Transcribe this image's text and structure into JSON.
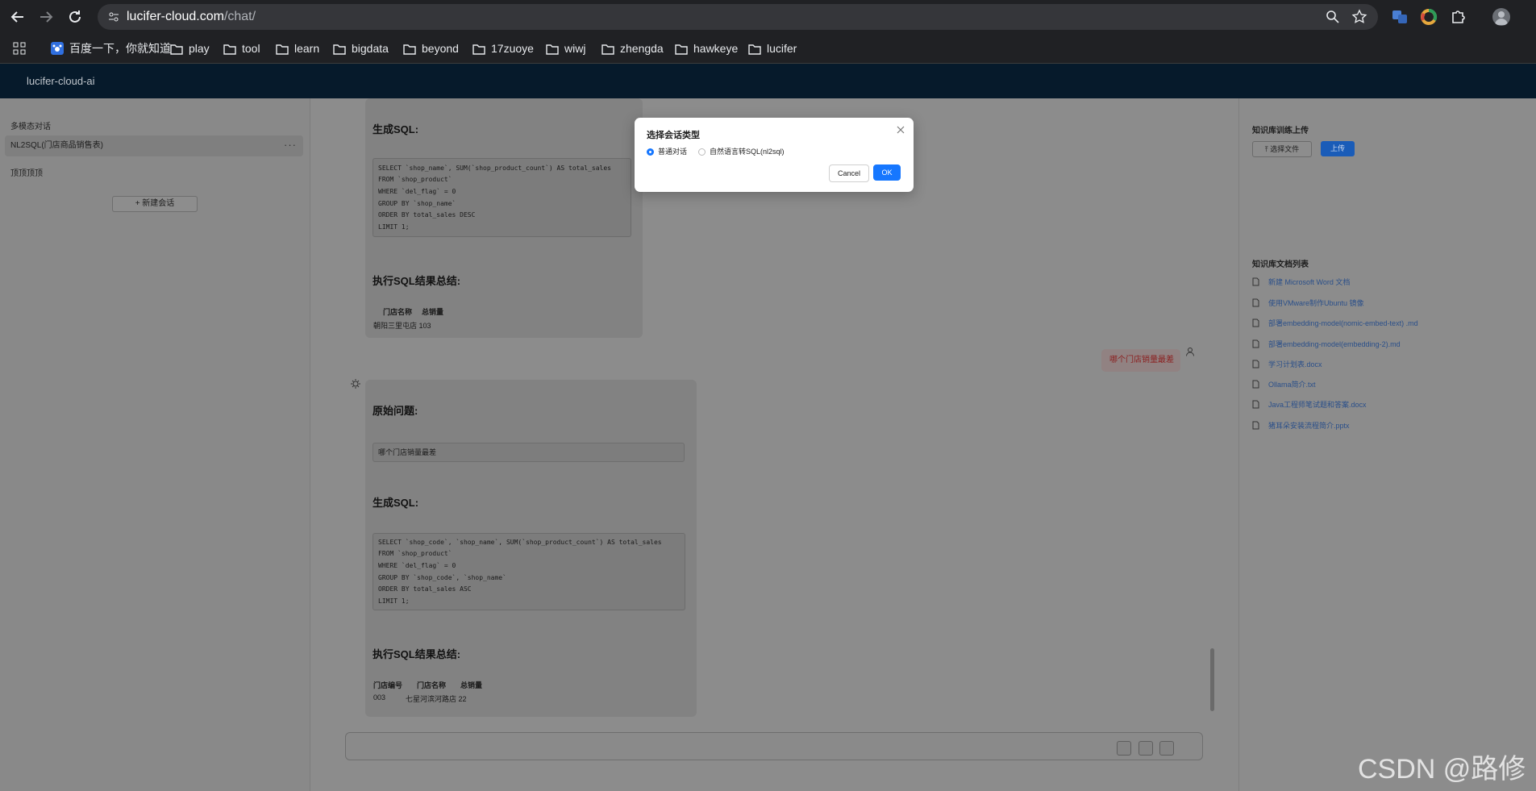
{
  "browser": {
    "url_host": "lucifer-cloud.com",
    "url_path": "/chat/",
    "bookmarks": [
      "百度一下，你就知道",
      "play",
      "tool",
      "learn",
      "bigdata",
      "beyond",
      "17zuoye",
      "wiwj",
      "zhengda",
      "hawkeye",
      "lucifer"
    ]
  },
  "header": {
    "title": "lucifer-cloud-ai"
  },
  "sidebar": {
    "section_label": "多模态对话",
    "items": [
      {
        "label": "NL2SQL(门店商品销售表)",
        "more": "···"
      },
      {
        "label": "顶顶顶顶"
      }
    ],
    "new_chat_label": "+ 新建会话"
  },
  "chat": {
    "msg1": {
      "gen_sql_title": "生成SQL:",
      "sql_lines": [
        "SELECT `shop_name`, SUM(`shop_product_count`) AS total_sales",
        "FROM `shop_product`",
        "WHERE `del_flag` = 0",
        "GROUP BY `shop_name`",
        "ORDER BY total_sales DESC",
        "LIMIT 1;"
      ],
      "result_title": "执行SQL结果总结:",
      "table_headers": [
        "门店名称",
        "总销量"
      ],
      "table_row": "朝阳三里屯店 103"
    },
    "user_msg": "哪个门店销量最差",
    "msg2": {
      "question_title": "原始问题:",
      "question": "哪个门店销量最差",
      "gen_sql_title": "生成SQL:",
      "sql_lines": [
        "SELECT `shop_code`, `shop_name`, SUM(`shop_product_count`) AS total_sales",
        "FROM `shop_product`",
        "WHERE `del_flag` = 0",
        "GROUP BY `shop_code`, `shop_name`",
        "ORDER BY total_sales ASC",
        "LIMIT 1;"
      ],
      "result_title": "执行SQL结果总结:",
      "table_headers": [
        "门店编号",
        "门店名称",
        "总销量"
      ],
      "table_row": [
        "003",
        "七星河滨河路店 22"
      ]
    }
  },
  "right_panel": {
    "upload_title": "知识库训练上传",
    "choose_file": "⤒ 选择文件",
    "upload": "上传",
    "list_title": "知识库文档列表",
    "files": [
      "新建 Microsoft Word 文档",
      "使用VMware制作Ubuntu 镜像",
      "部署embedding-model(nomic-embed-text) .md",
      "部署embedding-model(embedding-2).md",
      "学习计划表.docx",
      "Ollama简介.txt",
      "Java工程师笔试题和答案.docx",
      "猪耳朵安装流程简介.pptx"
    ]
  },
  "modal": {
    "title": "选择会话类型",
    "option_normal": "普通对话",
    "option_nl2sql": "自然语言转SQL(nl2sql)",
    "cancel": "Cancel",
    "ok": "OK"
  },
  "watermark": "CSDN @路修"
}
